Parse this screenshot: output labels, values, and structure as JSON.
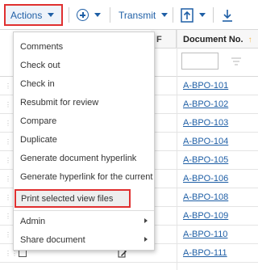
{
  "toolbar": {
    "actions_label": "Actions",
    "transmit_label": "Transmit",
    "add_icon": "add-circle-icon",
    "upload_icon": "upload-icon",
    "download_icon": "download-icon"
  },
  "table": {
    "col_document_no": "Document No.",
    "col_lock": "F",
    "rows": [
      "A-BPO-101",
      "A-BPO-102",
      "A-BPO-103",
      "A-BPO-104",
      "A-BPO-105",
      "A-BPO-106",
      "A-BPO-108",
      "A-BPO-109",
      "A-BPO-110",
      "A-BPO-111"
    ]
  },
  "menu": {
    "items": [
      "Comments",
      "Check out",
      "Check in",
      "Resubmit for review",
      "Compare",
      "Duplicate",
      "Generate document hyperlink",
      "Generate hyperlink for the current r...",
      "Print selected view files",
      "Admin",
      "Share document"
    ]
  },
  "colors": {
    "accent": "#1f5fa6",
    "highlight_box": "#e03030"
  }
}
